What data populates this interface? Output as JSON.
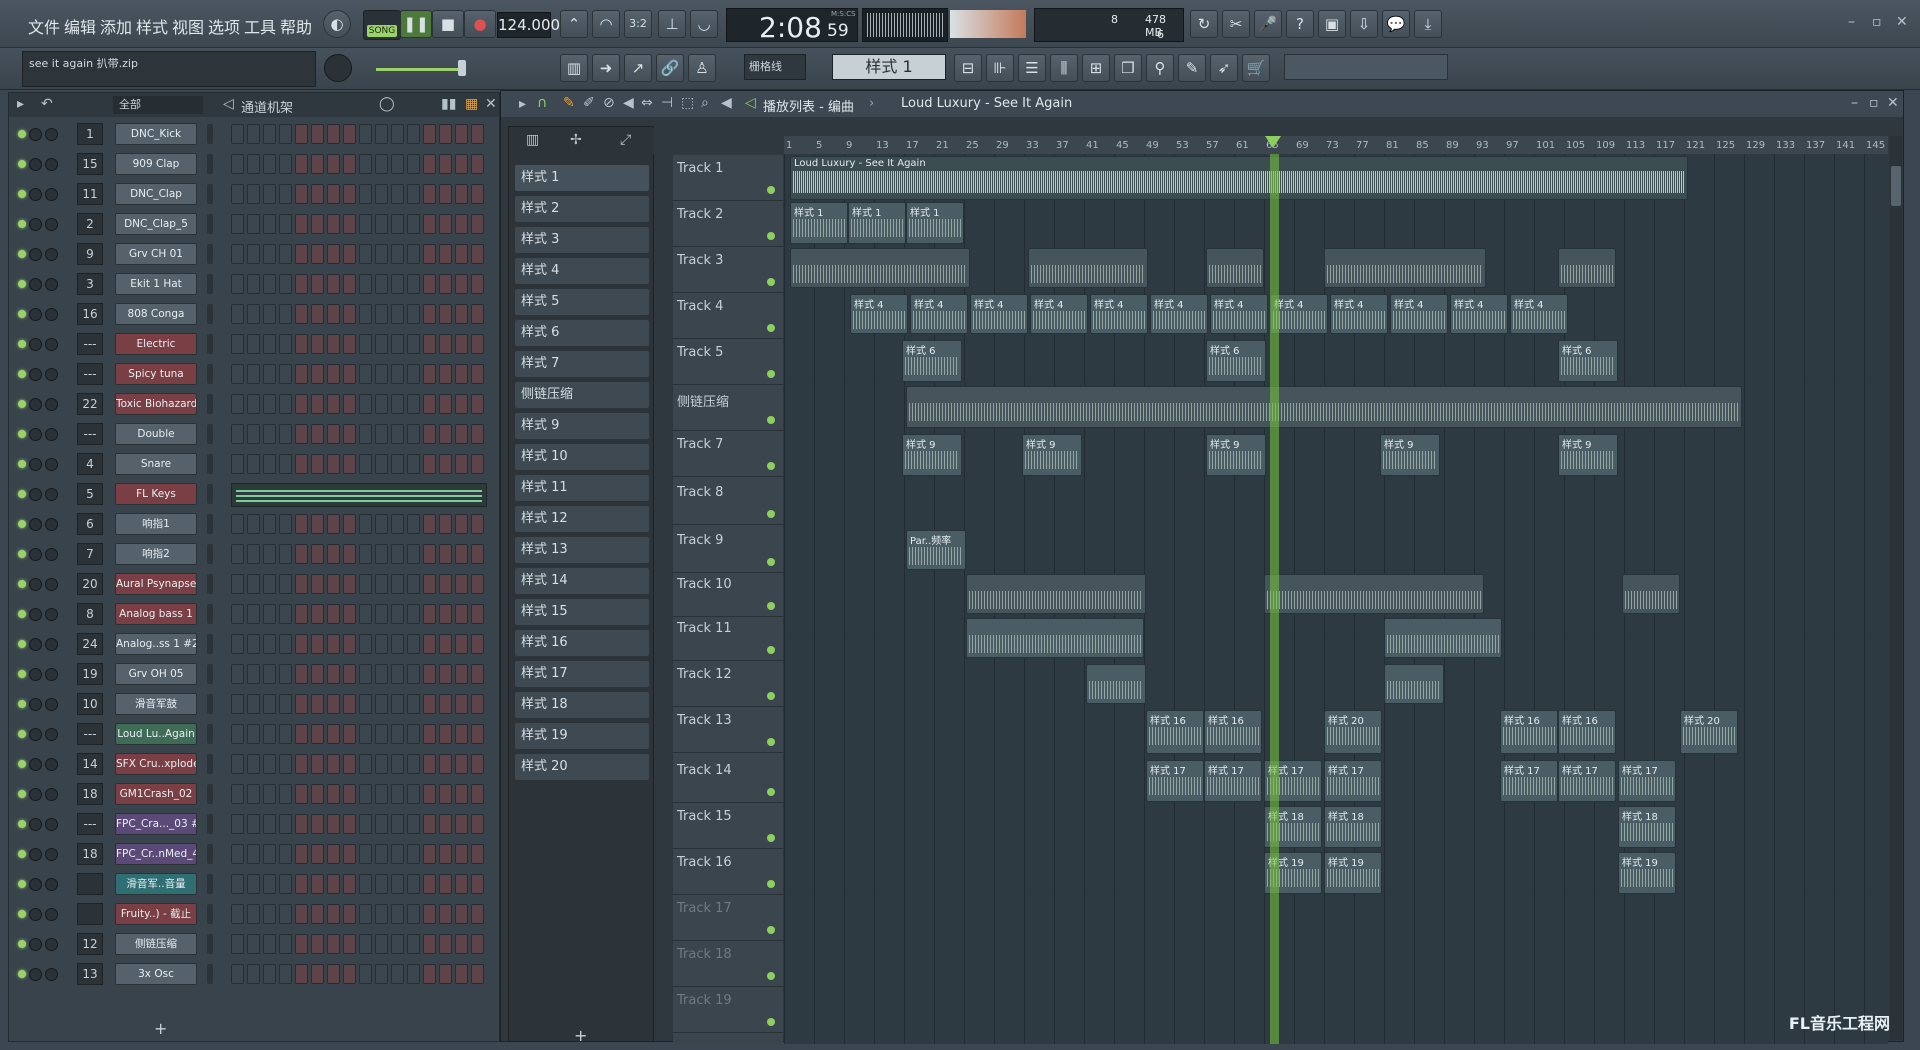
{
  "menu": [
    "文件",
    "编辑",
    "添加",
    "样式",
    "视图",
    "选项",
    "工具",
    "帮助"
  ],
  "transport": {
    "mode_label": "SONG",
    "tempo": "124.000",
    "time_display": "2:08",
    "time_sub": "59",
    "time_unit": "M:S:CS",
    "cpu_value": "8",
    "memory": "478 MB",
    "voices": "6"
  },
  "hint_bar": {
    "text": "see it again 扒带.zip"
  },
  "pattern_selector": {
    "label": "样式 1",
    "snap_label": "栅格线"
  },
  "channel_rack": {
    "filter_label": "全部",
    "title": "通道机架",
    "channels": [
      {
        "num": "1",
        "name": "DNC_Kick",
        "color": "grey"
      },
      {
        "num": "15",
        "name": "909 Clap",
        "color": "grey"
      },
      {
        "num": "11",
        "name": "DNC_Clap",
        "color": "grey"
      },
      {
        "num": "2",
        "name": "DNC_Clap_5",
        "color": "grey"
      },
      {
        "num": "9",
        "name": "Grv CH 01",
        "color": "grey"
      },
      {
        "num": "3",
        "name": "Ekit 1 Hat",
        "color": "grey"
      },
      {
        "num": "16",
        "name": "808 Conga",
        "color": "grey"
      },
      {
        "num": "---",
        "name": "Electric",
        "color": "red"
      },
      {
        "num": "---",
        "name": "Spicy tuna",
        "color": "red"
      },
      {
        "num": "22",
        "name": "Toxic Biohazard",
        "color": "red"
      },
      {
        "num": "---",
        "name": "Double",
        "color": "grey"
      },
      {
        "num": "4",
        "name": "Snare",
        "color": "grey"
      },
      {
        "num": "5",
        "name": "FL Keys",
        "color": "red"
      },
      {
        "num": "6",
        "name": "响指1",
        "color": "grey"
      },
      {
        "num": "7",
        "name": "响指2",
        "color": "grey"
      },
      {
        "num": "20",
        "name": "Aural Psynapse",
        "color": "red"
      },
      {
        "num": "8",
        "name": "Analog bass 1",
        "color": "red"
      },
      {
        "num": "24",
        "name": "Analog..ss 1 #2",
        "color": "grey"
      },
      {
        "num": "19",
        "name": "Grv OH 05",
        "color": "grey"
      },
      {
        "num": "10",
        "name": "滑音军鼓",
        "color": "grey"
      },
      {
        "num": "---",
        "name": "Loud Lu..Again",
        "color": "green"
      },
      {
        "num": "14",
        "name": "SFX Cru..xplode",
        "color": "red"
      },
      {
        "num": "18",
        "name": "GM1Crash_02",
        "color": "red"
      },
      {
        "num": "---",
        "name": "FPC_Cra..._03 #2",
        "color": "purple"
      },
      {
        "num": "18",
        "name": "FPC_Cr..nMed_4",
        "color": "purple"
      },
      {
        "num": "",
        "name": "滑音军..音量",
        "color": "teal"
      },
      {
        "num": "",
        "name": "Fruity..) - 截止",
        "color": "red"
      },
      {
        "num": "12",
        "name": "侧链压缩",
        "color": "grey"
      },
      {
        "num": "13",
        "name": "3x Osc",
        "color": "grey"
      }
    ],
    "add_label": "+"
  },
  "patterns": [
    "样式 1",
    "样式 2",
    "样式 3",
    "样式 4",
    "样式 5",
    "样式 6",
    "样式 7",
    "侧链压缩",
    "样式 9",
    "样式 10",
    "样式 11",
    "样式 12",
    "样式 13",
    "样式 14",
    "样式 15",
    "样式 16",
    "样式 17",
    "样式 18",
    "样式 19",
    "样式 20"
  ],
  "playlist": {
    "title": "播放列表 - 编曲",
    "breadcrumb": "Loud Luxury - See It Again",
    "bar_numbers": [
      "1",
      "5",
      "9",
      "13",
      "17",
      "21",
      "25",
      "29",
      "33",
      "37",
      "41",
      "45",
      "49",
      "53",
      "57",
      "61",
      "65",
      "69",
      "73",
      "77",
      "81",
      "85",
      "89",
      "93",
      "97",
      "101",
      "105",
      "109",
      "113",
      "117",
      "121",
      "125",
      "129",
      "133",
      "137",
      "141",
      "145"
    ],
    "tracks": [
      "Track 1",
      "Track 2",
      "Track 3",
      "Track 4",
      "Track 5",
      "侧链压缩",
      "Track 7",
      "Track 8",
      "Track 9",
      "Track 10",
      "Track 11",
      "Track 12",
      "Track 13",
      "Track 14",
      "Track 15",
      "Track 16",
      "Track 17",
      "Track 18",
      "Track 19"
    ],
    "audio_clip_label": "Loud Luxury - See It Again",
    "clip_labels": {
      "p1": "样式 1",
      "p4": "样式 4",
      "p6": "样式 6",
      "p9": "样式 9",
      "p16": "样式 16",
      "p17": "样式 17",
      "p18": "样式 18",
      "p19": "样式 19",
      "p20": "样式 20",
      "auto": "Par..频率"
    }
  },
  "watermark": "FL音乐工程网"
}
